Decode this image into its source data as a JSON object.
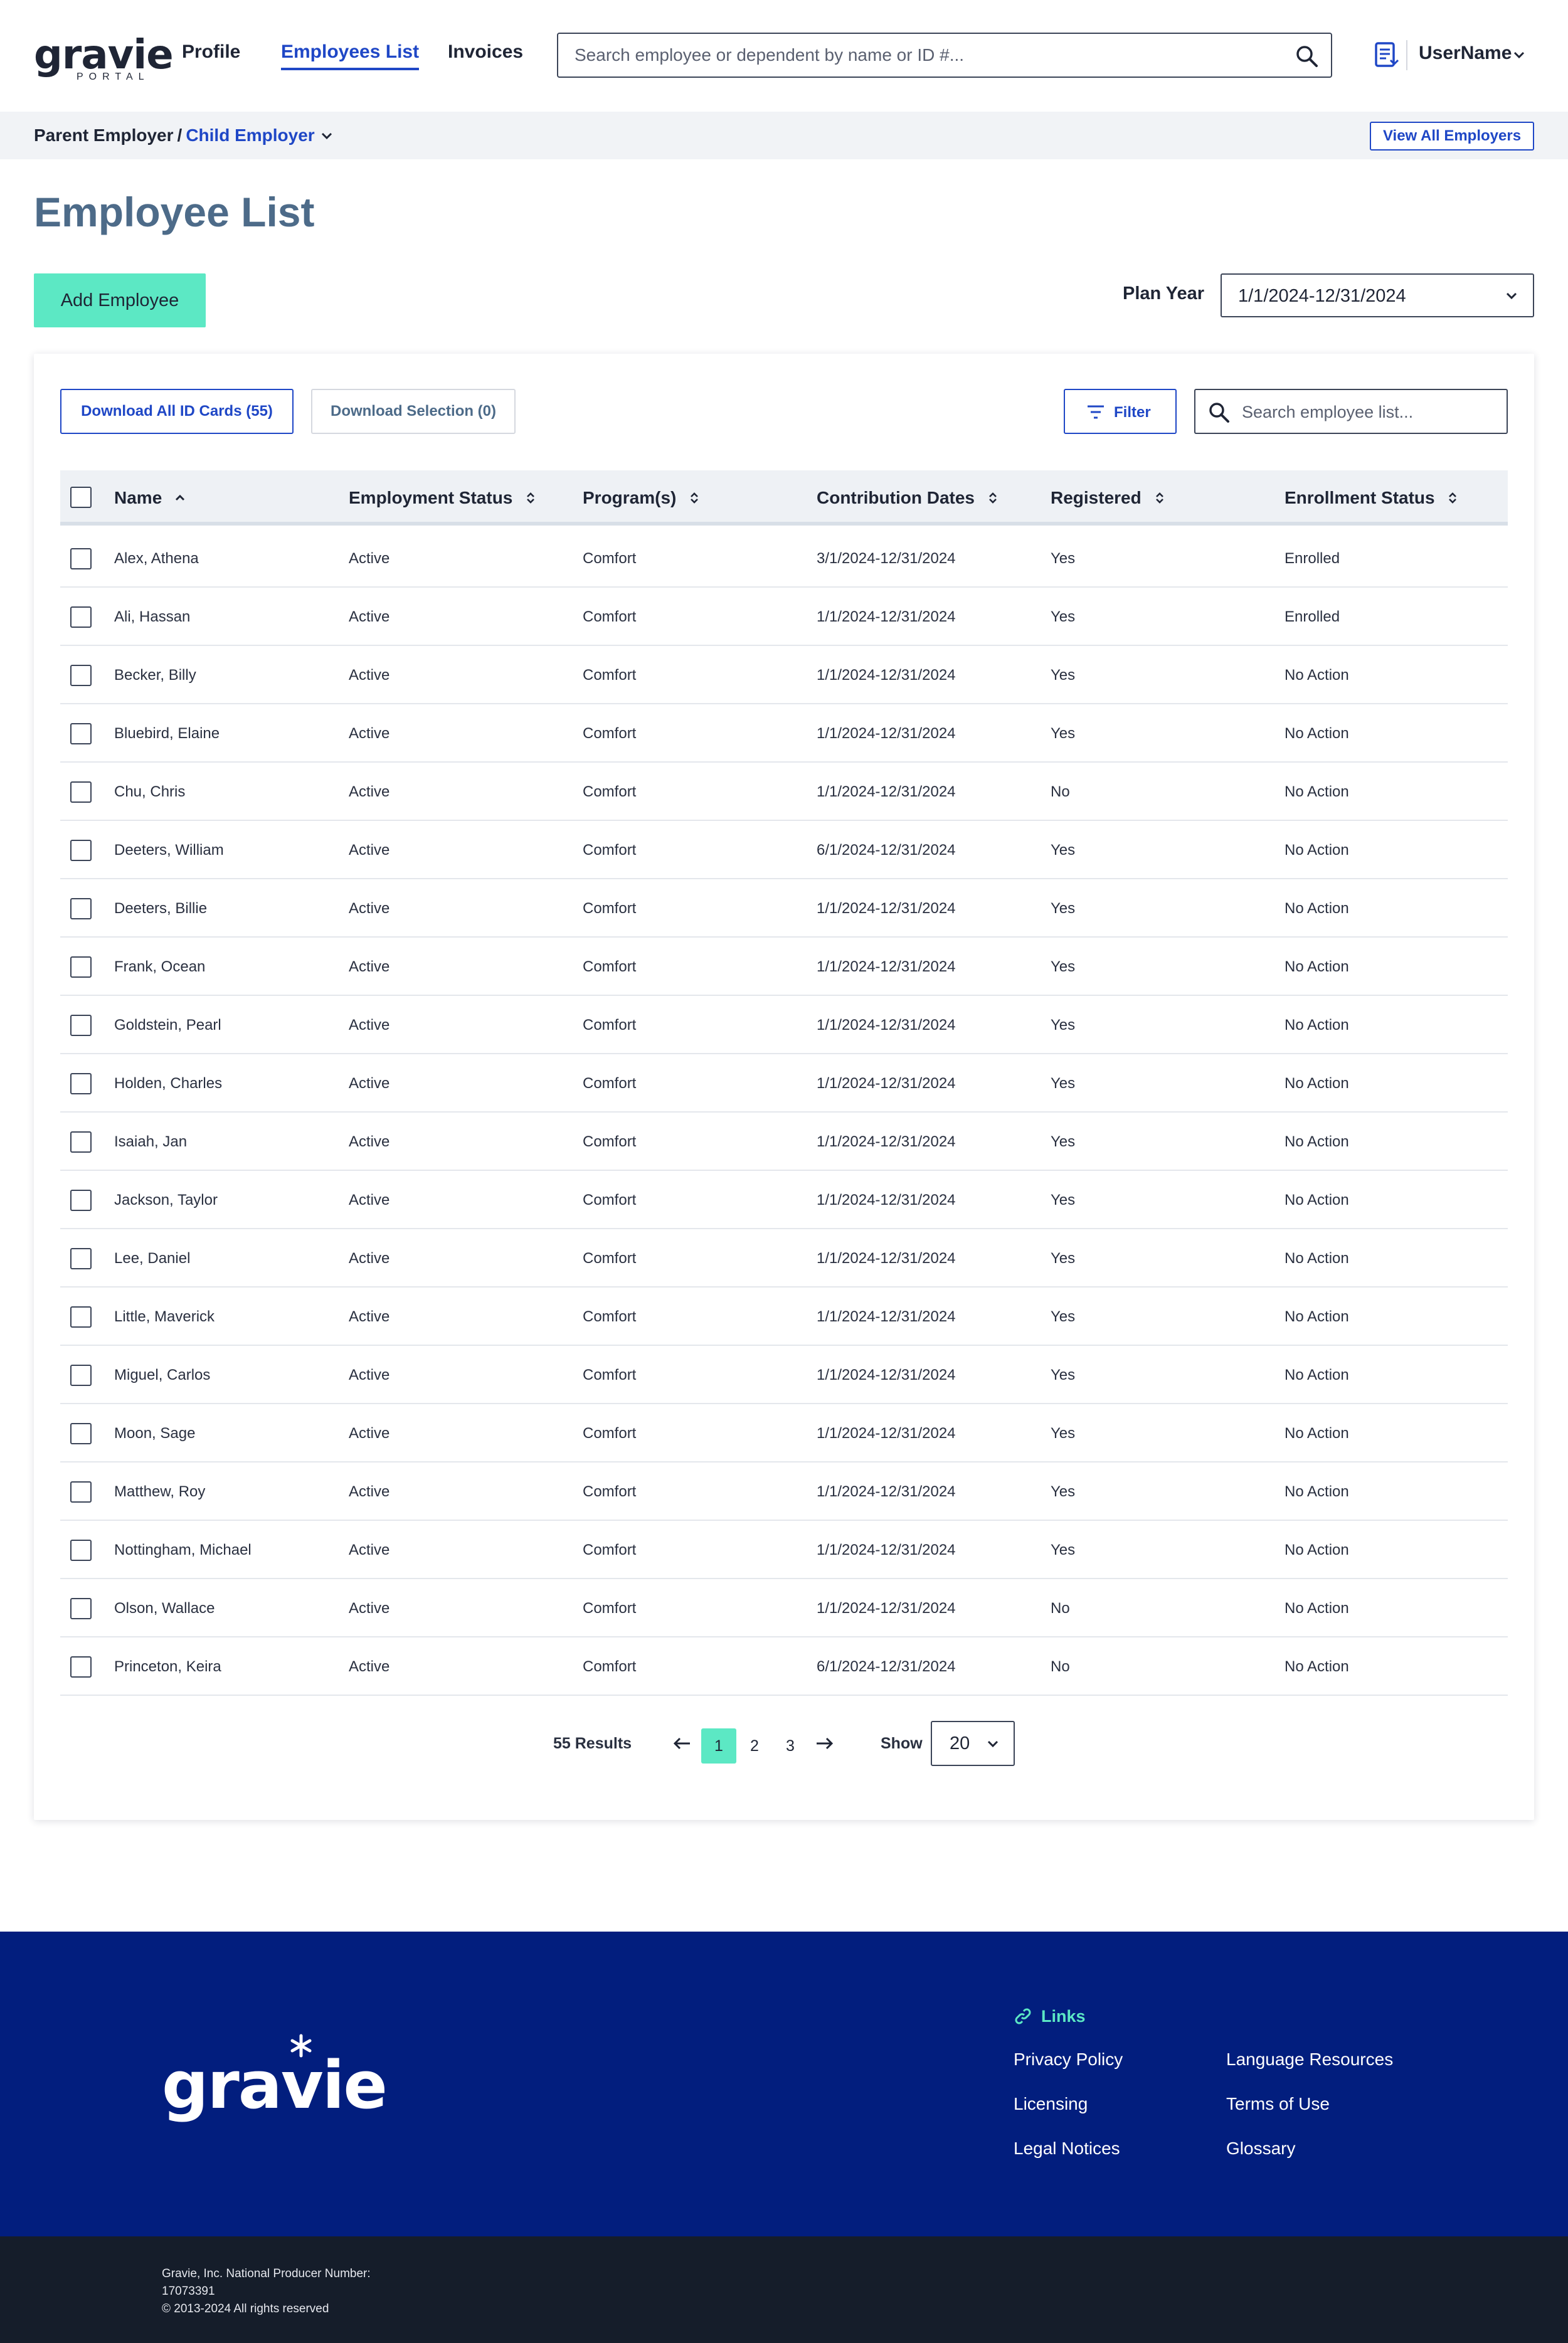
{
  "nav": {
    "logo_text": "gravie",
    "logo_sub": "PORTAL",
    "links": [
      "Profile",
      "Employees List",
      "Invoices"
    ],
    "active_link": "Employees List",
    "search_placeholder": "Search employee or dependent by name or ID #...",
    "username": "UserName"
  },
  "breadcrumb": {
    "parent": "Parent Employer",
    "separator": "/",
    "child": "Child Employer",
    "view_all_label": "View All Employers"
  },
  "page": {
    "title": "Employee List",
    "add_button": "Add Employee",
    "plan_year_label": "Plan Year",
    "plan_year_value": "1/1/2024-12/31/2024"
  },
  "toolbar": {
    "download_all": "Download All ID Cards (55)",
    "download_selection": "Download Selection (0)",
    "filter": "Filter",
    "search_placeholder": "Search employee list..."
  },
  "table": {
    "columns": [
      "Name",
      "Employment Status",
      "Program(s)",
      "Contribution Dates",
      "Registered",
      "Enrollment  Status"
    ],
    "rows": [
      [
        "Alex, Athena",
        "Active",
        "Comfort",
        "3/1/2024-12/31/2024",
        "Yes",
        "Enrolled"
      ],
      [
        "Ali, Hassan",
        "Active",
        "Comfort",
        "1/1/2024-12/31/2024",
        "Yes",
        "Enrolled"
      ],
      [
        "Becker, Billy",
        "Active",
        "Comfort",
        "1/1/2024-12/31/2024",
        "Yes",
        "No Action"
      ],
      [
        "Bluebird, Elaine",
        "Active",
        "Comfort",
        "1/1/2024-12/31/2024",
        "Yes",
        "No Action"
      ],
      [
        "Chu, Chris",
        "Active",
        "Comfort",
        "1/1/2024-12/31/2024",
        "No",
        "No Action"
      ],
      [
        "Deeters, William",
        "Active",
        "Comfort",
        "6/1/2024-12/31/2024",
        "Yes",
        "No Action"
      ],
      [
        "Deeters, Billie",
        "Active",
        "Comfort",
        "1/1/2024-12/31/2024",
        "Yes",
        "No Action"
      ],
      [
        "Frank, Ocean",
        "Active",
        "Comfort",
        "1/1/2024-12/31/2024",
        "Yes",
        "No Action"
      ],
      [
        "Goldstein, Pearl",
        "Active",
        "Comfort",
        "1/1/2024-12/31/2024",
        "Yes",
        "No Action"
      ],
      [
        "Holden, Charles",
        "Active",
        "Comfort",
        "1/1/2024-12/31/2024",
        "Yes",
        "No Action"
      ],
      [
        "Isaiah, Jan",
        "Active",
        "Comfort",
        "1/1/2024-12/31/2024",
        "Yes",
        "No Action"
      ],
      [
        "Jackson, Taylor",
        "Active",
        "Comfort",
        "1/1/2024-12/31/2024",
        "Yes",
        "No Action"
      ],
      [
        "Lee, Daniel",
        "Active",
        "Comfort",
        "1/1/2024-12/31/2024",
        "Yes",
        "No Action"
      ],
      [
        "Little, Maverick",
        "Active",
        "Comfort",
        "1/1/2024-12/31/2024",
        "Yes",
        "No Action"
      ],
      [
        "Miguel, Carlos",
        "Active",
        "Comfort",
        "1/1/2024-12/31/2024",
        "Yes",
        "No Action"
      ],
      [
        "Moon, Sage",
        "Active",
        "Comfort",
        "1/1/2024-12/31/2024",
        "Yes",
        "No Action"
      ],
      [
        "Matthew, Roy",
        "Active",
        "Comfort",
        "1/1/2024-12/31/2024",
        "Yes",
        "No Action"
      ],
      [
        "Nottingham, Michael",
        "Active",
        "Comfort",
        "1/1/2024-12/31/2024",
        "Yes",
        "No Action"
      ],
      [
        "Olson, Wallace",
        "Active",
        "Comfort",
        "1/1/2024-12/31/2024",
        "No",
        "No Action"
      ],
      [
        "Princeton, Keira",
        "Active",
        "Comfort",
        "6/1/2024-12/31/2024",
        "No",
        "No Action"
      ]
    ]
  },
  "pagination": {
    "results": "55 Results",
    "pages": [
      "1",
      "2",
      "3"
    ],
    "current_page": "1",
    "show_label": "Show",
    "page_size": "20"
  },
  "footer": {
    "logo_text": "gravie",
    "links_heading": "Links",
    "links": [
      "Privacy Policy",
      "Language Resources",
      "Licensing",
      "Terms of Use",
      "Legal Notices",
      "Glossary"
    ],
    "producer_line": "Gravie, Inc. National Producer Number: 17073391",
    "copyright": "© 2013-2024 All rights reserved"
  },
  "colors": {
    "brand_blue": "#1f47c6",
    "accent_mint": "#5ce8c4",
    "title_slate": "#4d6b89",
    "footer_navy": "#021e7e",
    "bottom_bar": "#151d2a"
  },
  "icons": [
    "search-icon",
    "document-icon",
    "chevron-down-icon",
    "sort-icon",
    "filter-icon",
    "arrow-left-icon",
    "arrow-right-icon",
    "link-icon"
  ]
}
